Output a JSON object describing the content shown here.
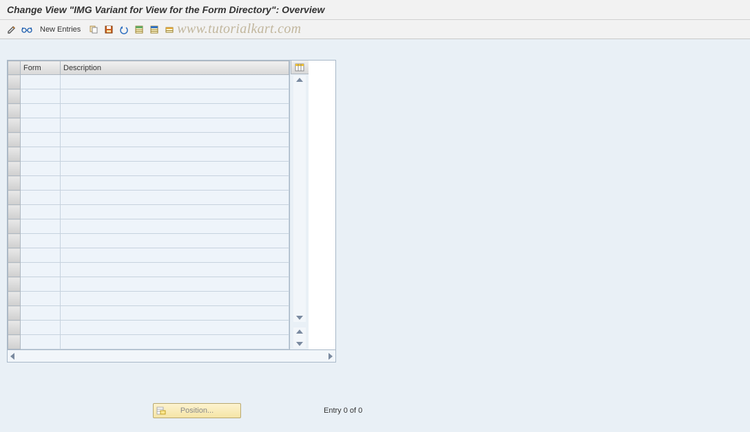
{
  "title": "Change View \"IMG Variant for View for the Form Directory\": Overview",
  "toolbar": {
    "new_entries": "New Entries"
  },
  "watermark": "www.tutorialkart.com",
  "table": {
    "headers": {
      "form": "Form",
      "description": "Description"
    },
    "row_count": 19
  },
  "footer": {
    "position_label": "Position...",
    "entry_text": "Entry 0 of 0"
  },
  "icons": {
    "pencil": "pencil-icon",
    "glasses": "glasses-icon",
    "copy": "copy-icon",
    "save": "save-icon",
    "undo": "undo-icon",
    "select_all": "select-all-icon",
    "deselect_all": "deselect-all-icon",
    "transport": "transport-icon",
    "table_settings": "table-settings-icon",
    "position": "position-icon"
  }
}
